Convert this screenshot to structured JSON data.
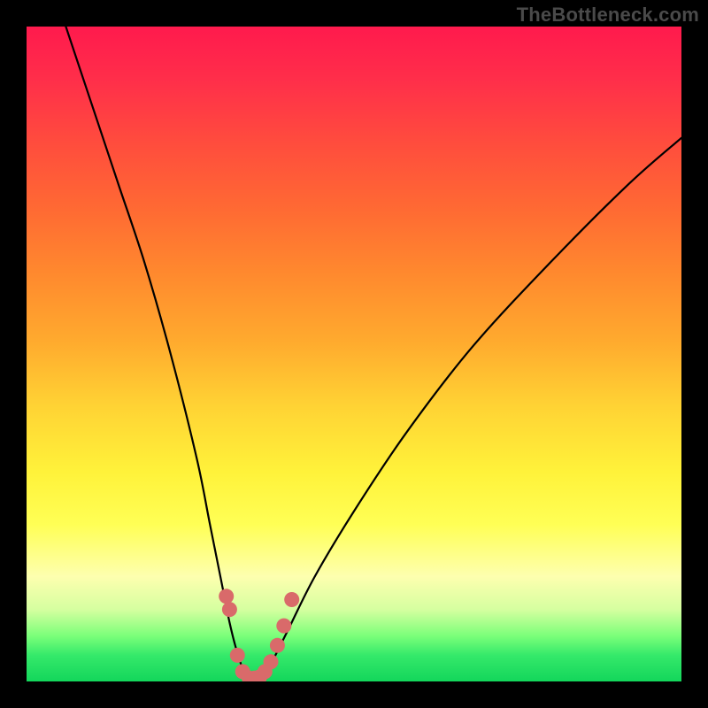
{
  "watermark": {
    "text": "TheBottleneck.com"
  },
  "chart_data": {
    "type": "line",
    "title": "",
    "xlabel": "",
    "ylabel": "",
    "xlim": [
      0,
      100
    ],
    "ylim": [
      0,
      100
    ],
    "series": [
      {
        "name": "bottleneck-curve",
        "x": [
          6,
          10,
          14,
          18,
          22,
          26,
          28,
          30,
          31,
          32,
          33,
          34,
          35,
          36,
          37,
          38,
          40,
          44,
          50,
          58,
          68,
          80,
          92,
          100
        ],
        "values": [
          100,
          88,
          76,
          64,
          50,
          34,
          24,
          14,
          9,
          5,
          2,
          0.5,
          0,
          0.5,
          2,
          4,
          8,
          16,
          26,
          38,
          51,
          64,
          76,
          83
        ]
      }
    ],
    "markers": {
      "name": "highlight-dots",
      "color": "#d96a6a",
      "x": [
        30.5,
        31.0,
        32.2,
        33.0,
        34.0,
        34.8,
        35.6,
        36.4,
        37.3,
        38.3,
        39.3,
        40.5
      ],
      "values": [
        13.0,
        11.0,
        4.0,
        1.5,
        0.5,
        0.5,
        0.7,
        1.5,
        3.0,
        5.5,
        8.5,
        12.5
      ]
    }
  }
}
